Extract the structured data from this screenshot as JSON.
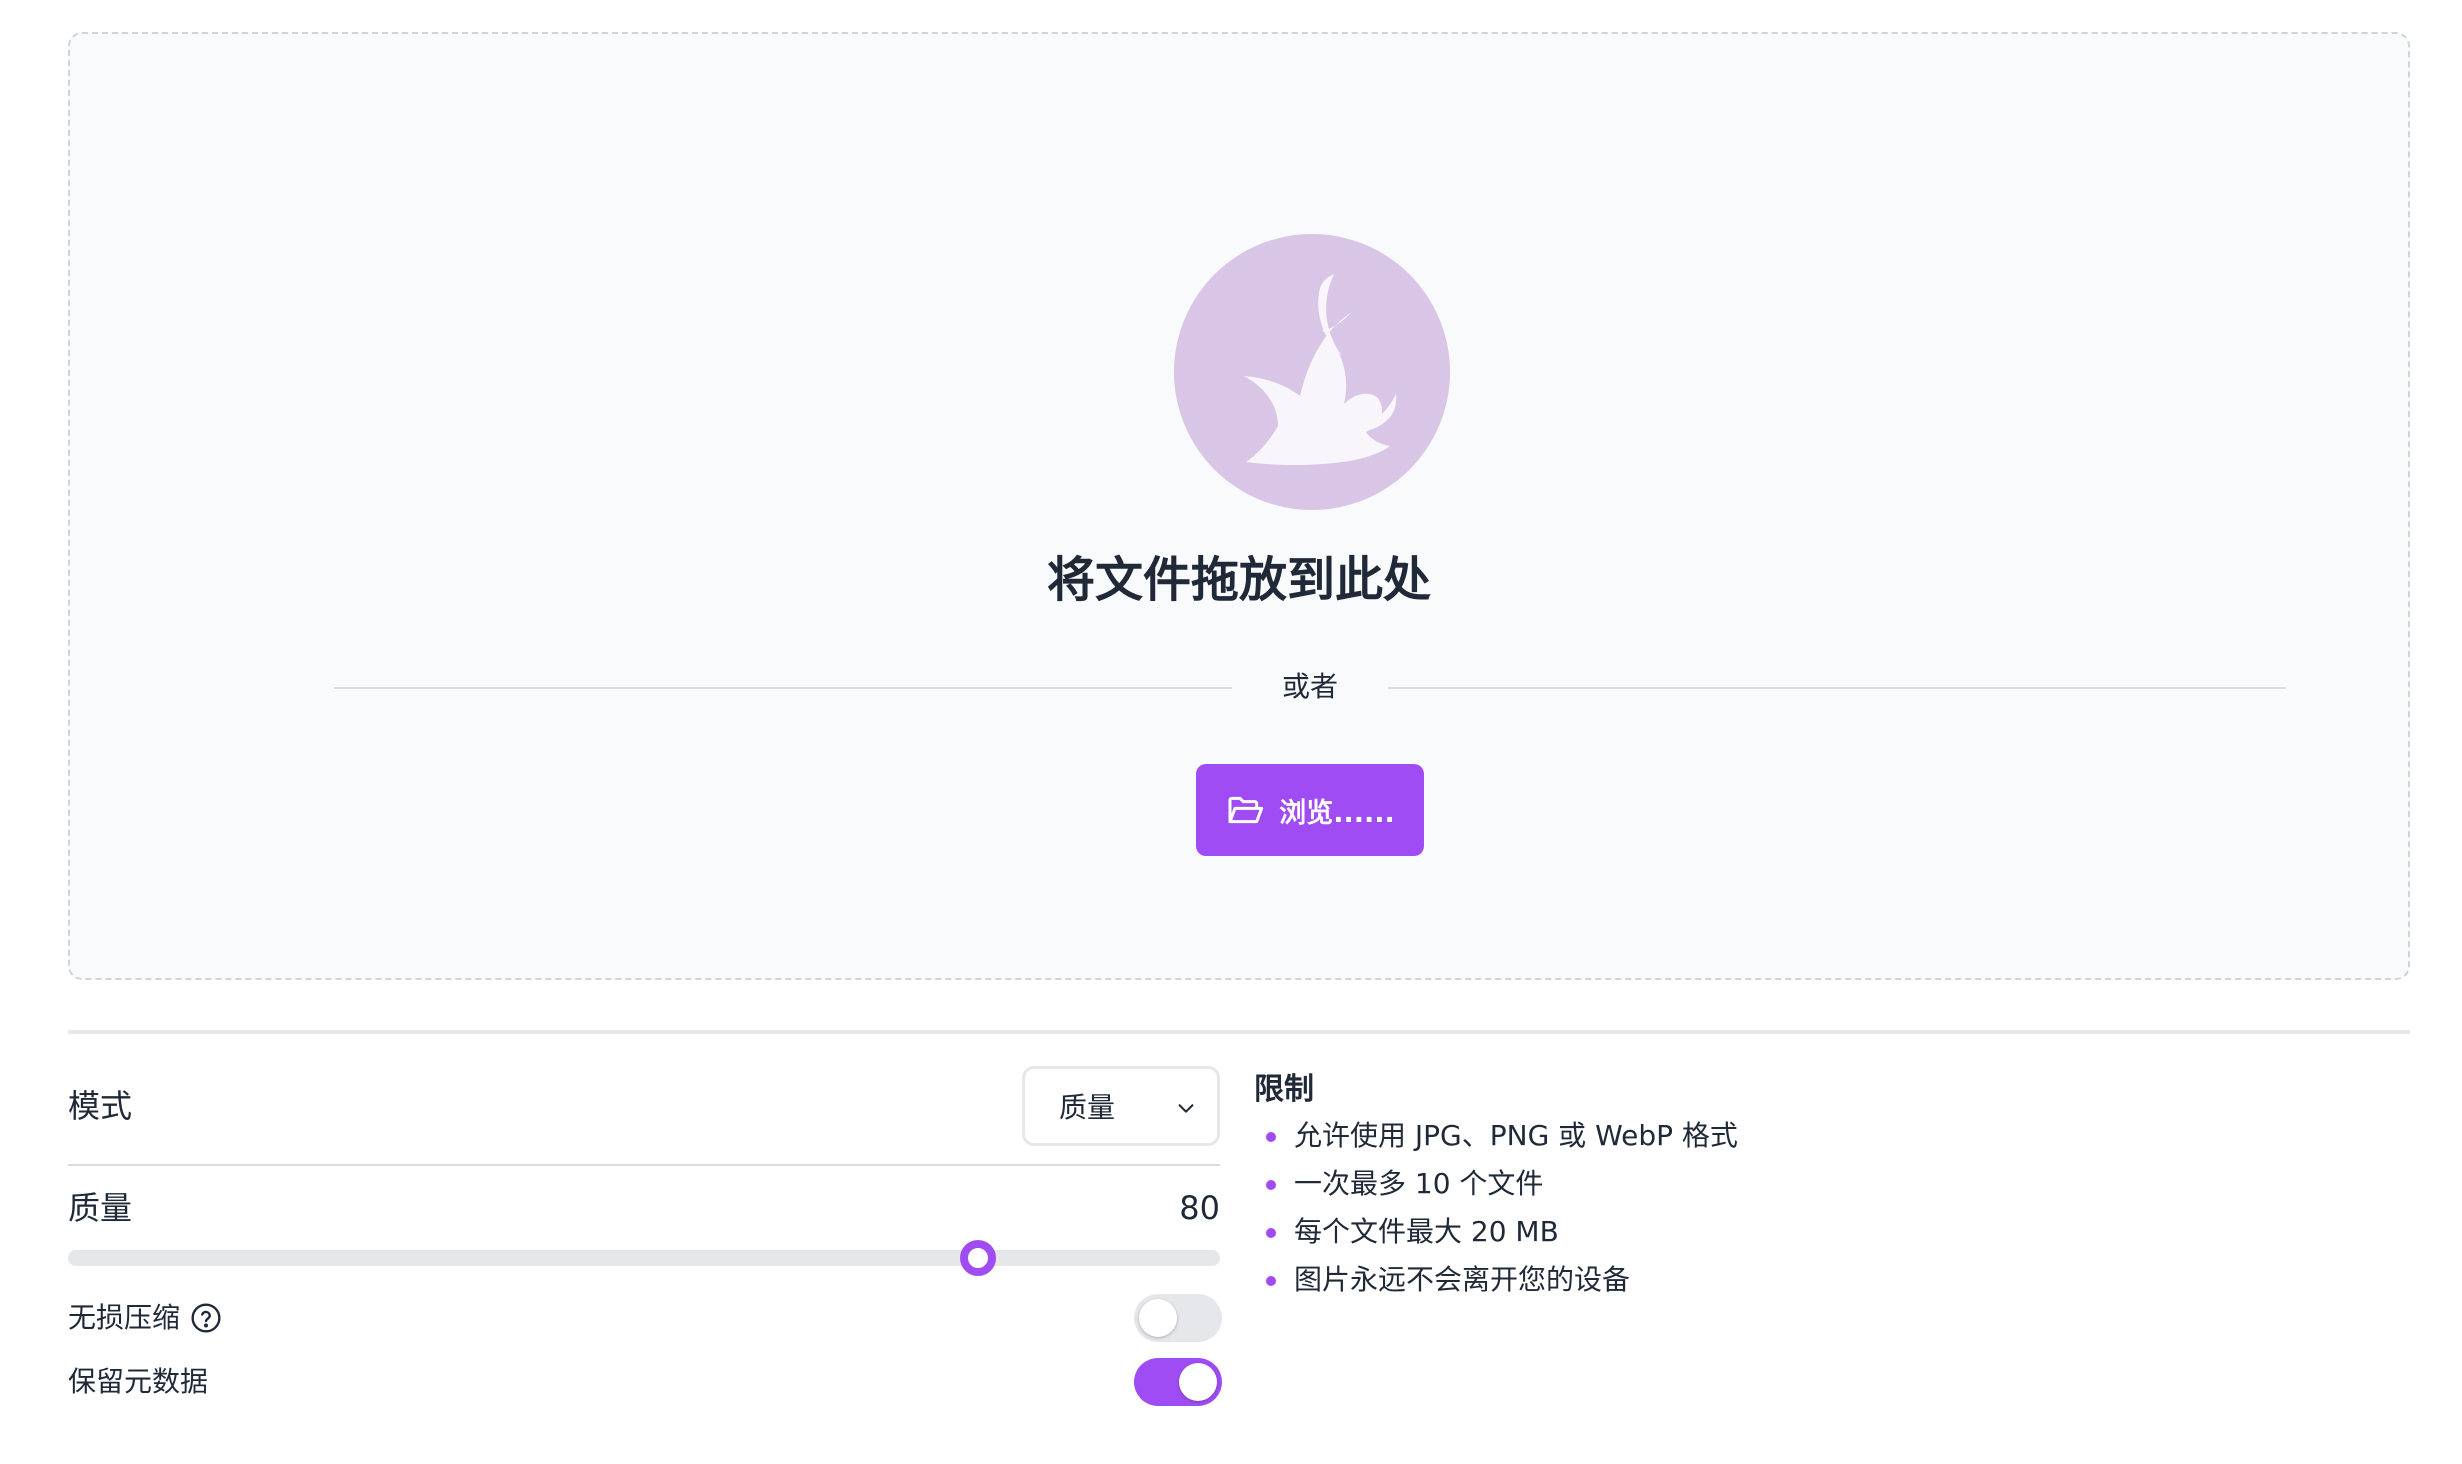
{
  "colors": {
    "accent": "#a04cf5",
    "logo_circle": "#d9c5e6",
    "dropzone_bg": "#f9fafb",
    "track": "#e5e7eb"
  },
  "dropzone": {
    "logo_icon": "phoenix-logo-icon",
    "title": "将文件拖放到此处",
    "or_text": "或者",
    "browse_label": "浏览......",
    "browse_icon": "folder-open-icon"
  },
  "settings": {
    "mode_label": "模式",
    "mode_selected": "质量",
    "quality_label": "质量",
    "quality_value": "80",
    "quality_fraction": 0.79,
    "lossless_label": "无损压缩",
    "lossless_on": false,
    "metadata_label": "保留元数据",
    "metadata_on": true
  },
  "limits": {
    "title": "限制",
    "items": [
      "允许使用 JPG、PNG 或 WebP 格式",
      "一次最多 10 个文件",
      "每个文件最大 20 MB",
      "图片永远不会离开您的设备"
    ]
  }
}
